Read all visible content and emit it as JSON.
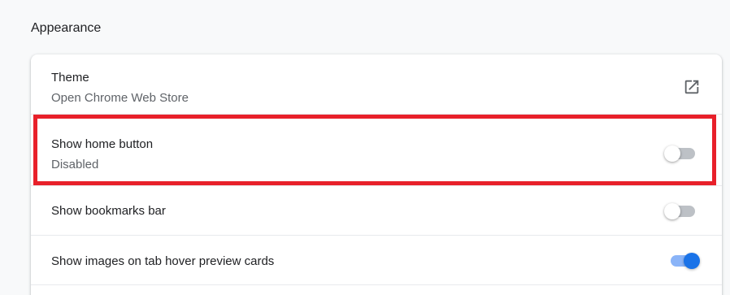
{
  "section": {
    "title": "Appearance"
  },
  "rows": {
    "theme": {
      "label": "Theme",
      "sublabel": "Open Chrome Web Store",
      "icon": "open-in-new-icon"
    },
    "home_button": {
      "label": "Show home button",
      "sublabel": "Disabled",
      "enabled": false
    },
    "bookmarks_bar": {
      "label": "Show bookmarks bar",
      "enabled": false
    },
    "tab_hover": {
      "label": "Show images on tab hover preview cards",
      "enabled": true
    }
  },
  "colors": {
    "highlight": "#e8202a",
    "toggle_on": "#1a73e8",
    "toggle_off": "#bdc1c6"
  }
}
